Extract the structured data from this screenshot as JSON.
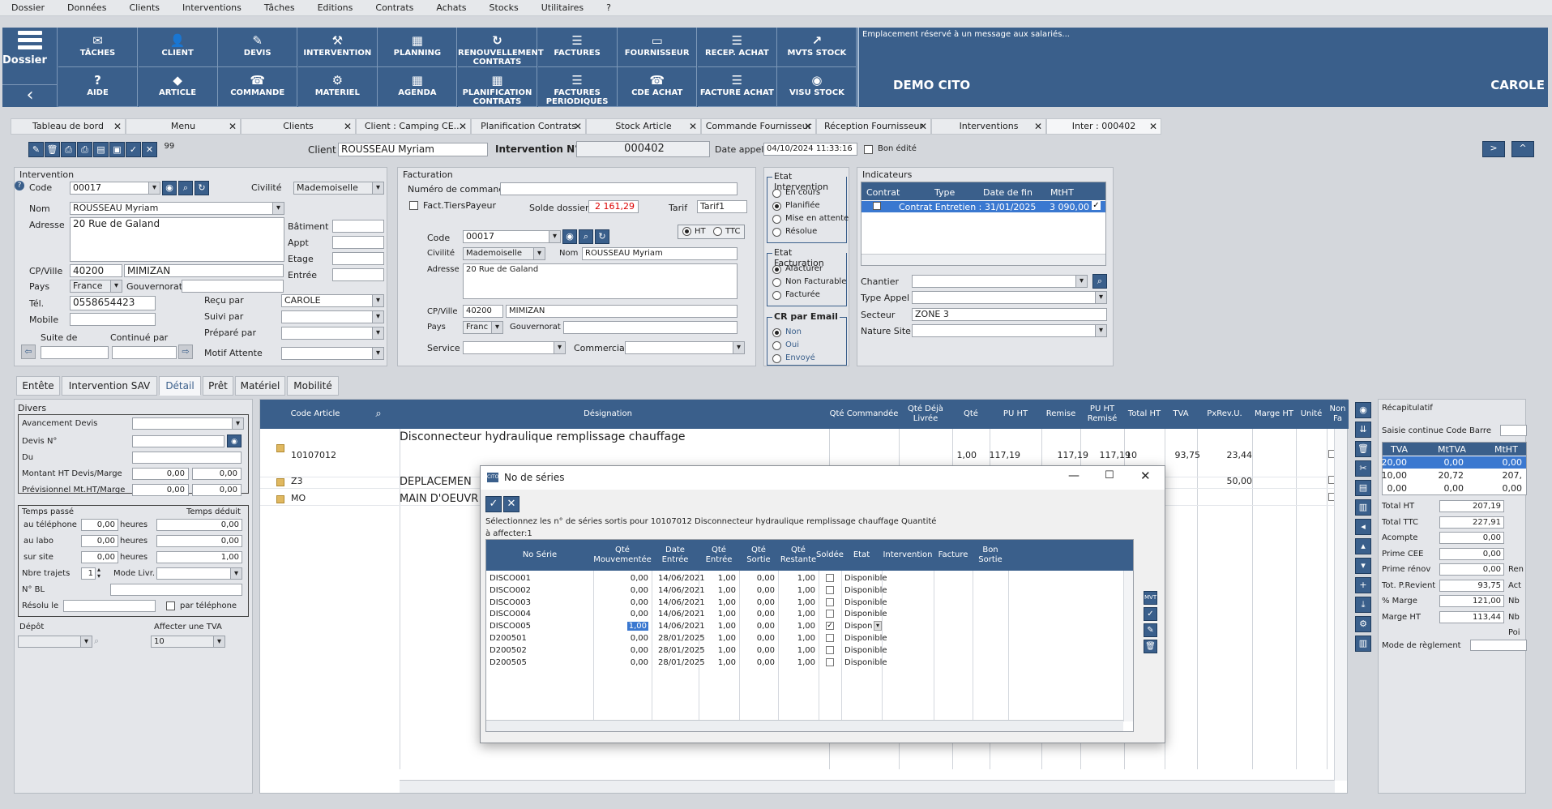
{
  "menu": [
    "Dossier",
    "Données",
    "Clients",
    "Interventions",
    "Tâches",
    "Editions",
    "Contrats",
    "Achats",
    "Stocks",
    "Utilitaires",
    "?"
  ],
  "ribbon": {
    "dossier": "Dossier",
    "row1": [
      {
        "icon": "✉",
        "label": "TÂCHES"
      },
      {
        "icon": "👤",
        "label": "CLIENT"
      },
      {
        "icon": "✎",
        "label": "DEVIS"
      },
      {
        "icon": "⚒",
        "label": "INTERVENTION"
      },
      {
        "icon": "▦",
        "label": "PLANNING"
      },
      {
        "icon": "↻",
        "label": "RENOUVELLEMENT CONTRATS"
      },
      {
        "icon": "☰",
        "label": "FACTURES"
      },
      {
        "icon": "▭",
        "label": "FOURNISSEUR"
      },
      {
        "icon": "☰",
        "label": "RECEP. ACHAT"
      },
      {
        "icon": "↗",
        "label": "MVTS STOCK"
      }
    ],
    "row2": [
      {
        "icon": "?",
        "label": "AIDE"
      },
      {
        "icon": "◆",
        "label": "ARTICLE"
      },
      {
        "icon": "☎",
        "label": "COMMANDE"
      },
      {
        "icon": "⚙",
        "label": "MATERIEL"
      },
      {
        "icon": "▦",
        "label": "AGENDA"
      },
      {
        "icon": "▦",
        "label": "PLANIFICATION CONTRATS"
      },
      {
        "icon": "☰",
        "label": "FACTURES PERIODIQUES"
      },
      {
        "icon": "☎",
        "label": "CDE ACHAT"
      },
      {
        "icon": "☰",
        "label": "FACTURE ACHAT"
      },
      {
        "icon": "◉",
        "label": "VISU STOCK"
      }
    ],
    "message": "Emplacement réservé à un  message aux salariés...",
    "company": "DEMO CITO",
    "user": "CAROLE"
  },
  "tabs": [
    "Tableau de bord",
    "Menu",
    "Clients",
    "Client : Camping CE...",
    "Planification Contrats",
    "Stock Article",
    "Commande Fournisseur",
    "Réception Fournisseur",
    "Interventions",
    "Inter : 000402"
  ],
  "toolbar": {
    "count": "99"
  },
  "header": {
    "client_label": "Client",
    "client": "ROUSSEAU Myriam",
    "inter_label": "Intervention N°",
    "inter": "000402",
    "date_label": "Date appel",
    "date": "04/10/2024 11:33:16",
    "bon_edite": "Bon édité"
  },
  "intervention": {
    "title": "Intervention",
    "code_label": "Code",
    "code": "00017",
    "civilite_label": "Civilité",
    "civilite": "Mademoiselle",
    "nom_label": "Nom",
    "nom": "ROUSSEAU Myriam",
    "adresse_label": "Adresse",
    "adresse": "20 Rue de Galand",
    "batiment": "Bâtiment",
    "appt": "Appt",
    "etage": "Etage",
    "entree": "Entrée",
    "cp_label": "CP/Ville",
    "cp": "40200",
    "ville": "MIMIZAN",
    "pays_label": "Pays",
    "pays": "France",
    "gouv_label": "Gouvernorat",
    "tel_label": "Tél.",
    "tel": "0558654423",
    "mobile_label": "Mobile",
    "recu_label": "Reçu par",
    "recu": "CAROLE",
    "suivi_label": "Suivi par",
    "prepare_label": "Préparé par",
    "suite_label": "Suite de",
    "continue_label": "Continué par",
    "motif_label": "Motif Attente"
  },
  "facturation": {
    "title": "Facturation",
    "numcmd": "Numéro de commande",
    "tiers": "Fact.TiersPayeur",
    "solde_label": "Solde dossier",
    "solde": "2 161,29",
    "tarif_label": "Tarif",
    "tarif": "Tarif1",
    "ht": "HT",
    "ttc": "TTC",
    "code_label": "Code",
    "code": "00017",
    "civilite_label": "Civilité",
    "civilite": "Mademoiselle",
    "nom_label": "Nom",
    "nom": "ROUSSEAU Myriam",
    "adresse_label": "Adresse",
    "adresse": "20 Rue de Galand",
    "cp_label": "CP/Ville",
    "cp": "40200",
    "ville": "MIMIZAN",
    "pays_label": "Pays",
    "pays": "Franc",
    "gouv_label": "Gouvernorat",
    "service_label": "Service",
    "commercial_label": "Commercial"
  },
  "etat_inter": {
    "title": "Etat Intervention",
    "options": [
      "En cours",
      "Planifiée",
      "Mise en attente",
      "Résolue"
    ]
  },
  "etat_fact": {
    "title": "Etat Facturation",
    "options": [
      "Afacturer",
      "Non Facturable",
      "Facturée"
    ]
  },
  "cr_email": {
    "title": "CR par Email",
    "options": [
      "Non",
      "Oui",
      "Envoyé"
    ]
  },
  "indicateurs": {
    "title": "Indicateurs",
    "cols": [
      "Contrat",
      "Type",
      "Date de fin",
      "MtHT"
    ],
    "row": [
      "Contrat Entretien :",
      "31/01/2025",
      "3 090,00"
    ],
    "chantier": "Chantier",
    "type_appel": "Type Appel",
    "secteur_label": "Secteur",
    "secteur": "ZONE 3",
    "nature": "Nature Site"
  },
  "subtabs": [
    "Entête",
    "Intervention SAV",
    "Détail",
    "Prêt",
    "Matériel",
    "Mobilité"
  ],
  "divers": {
    "title": "Divers",
    "avancement": "Avancement Devis",
    "devis": "Devis N°",
    "du": "Du",
    "montant": "Montant HT Devis/Marge",
    "montant_v1": "0,00",
    "montant_v2": "0,00",
    "prev": "Prévisionnel Mt.HT/Marge",
    "prev_v1": "0,00",
    "prev_v2": "0,00",
    "temps_passe": "Temps passé",
    "temps_deduit": "Temps déduit",
    "tel_lbl": "au téléphone",
    "tel_v": "0,00",
    "heures": "heures",
    "tel_d": "0,00",
    "labo_lbl": "au labo",
    "labo_v": "0,00",
    "labo_d": "0,00",
    "site_lbl": "sur site",
    "site_v": "0,00",
    "site_d": "1,00",
    "trajets": "Nbre trajets",
    "trajets_v": "1",
    "mode": "Mode Livr.",
    "nbl": "N° BL",
    "resolu": "Résolu le",
    "par_tel": "par téléphone",
    "depot": "Dépôt",
    "tva_lbl": "Affecter une TVA",
    "tva": "10"
  },
  "grid": {
    "cols": [
      "Code Article",
      "Désignation",
      "Qté Commandée",
      "Qté Déjà Livrée",
      "Qté",
      "PU HT",
      "Remise",
      "PU HT Remisé",
      "Total HT",
      "TVA",
      "PxRev.U.",
      "Marge HT",
      "Unité",
      "Non Fa"
    ],
    "rows": [
      {
        "code": "10107012",
        "des": "Disconnecteur hydraulique remplissage chauffage",
        "qte": "1,00",
        "pu": "117,19",
        "pur": "117,19",
        "tot": "117,19",
        "tva": "10",
        "pxrev": "93,75",
        "marge": "23,44"
      },
      {
        "code": "Z3",
        "des": "DEPLACEMEN",
        "marge": "50,00"
      },
      {
        "code": "MO",
        "des": "MAIN D'OEUVR"
      }
    ]
  },
  "recap": {
    "title": "Récapitulatif",
    "saisie": "Saisie continue Code Barre",
    "cols": [
      "TVA",
      "MtTVA",
      "MtHT"
    ],
    "rows": [
      [
        "20,00",
        "0,00",
        "0,00"
      ],
      [
        "10,00",
        "20,72",
        "207,"
      ],
      [
        "0,00",
        "0,00",
        "0,00"
      ]
    ],
    "totals": [
      [
        "Total HT",
        "207,19"
      ],
      [
        "Total TTC",
        "227,91"
      ],
      [
        "Acompte",
        "0,00"
      ],
      [
        "Prime CEE",
        "0,00"
      ],
      [
        "Prime rénov",
        "0,00"
      ],
      [
        "Tot. P.Revient",
        "93,75"
      ],
      [
        "% Marge",
        "121,00"
      ],
      [
        "Marge HT",
        "113,44"
      ]
    ],
    "side": [
      "Ren",
      "Act",
      "Nb",
      "Nb",
      "Poi"
    ],
    "reglement": "Mode de règlement"
  },
  "dialog": {
    "title": "No de séries",
    "instr": "Sélectionnez les n° de séries sortis pour 10107012 Disconnecteur hydraulique remplissage chauffage Quantité à affecter:1",
    "cols": [
      "No Série",
      "Qté Mouvementée",
      "Date Entrée",
      "Qté Entrée",
      "Qté Sortie",
      "Qté Restante",
      "Soldée",
      "Etat",
      "Intervention",
      "Facture",
      "Bon Sortie"
    ],
    "rows": [
      [
        "DISCO001",
        "0,00",
        "14/06/2021",
        "1,00",
        "0,00",
        "1,00",
        "Disponible"
      ],
      [
        "DISCO002",
        "0,00",
        "14/06/2021",
        "1,00",
        "0,00",
        "1,00",
        "Disponible"
      ],
      [
        "DISCO003",
        "0,00",
        "14/06/2021",
        "1,00",
        "0,00",
        "1,00",
        "Disponible"
      ],
      [
        "DISCO004",
        "0,00",
        "14/06/2021",
        "1,00",
        "0,00",
        "1,00",
        "Disponible"
      ],
      [
        "DISCO005",
        "1,00",
        "14/06/2021",
        "1,00",
        "0,00",
        "1,00",
        "Dispon"
      ],
      [
        "D200501",
        "0,00",
        "28/01/2025",
        "1,00",
        "0,00",
        "1,00",
        "Disponible"
      ],
      [
        "D200502",
        "0,00",
        "28/01/2025",
        "1,00",
        "0,00",
        "1,00",
        "Disponible"
      ],
      [
        "D200505",
        "0,00",
        "28/01/2025",
        "1,00",
        "0,00",
        "1,00",
        "Disponible"
      ]
    ]
  },
  "colors": {
    "accent": "#3a5f8b",
    "bg": "#d4d7dc"
  }
}
